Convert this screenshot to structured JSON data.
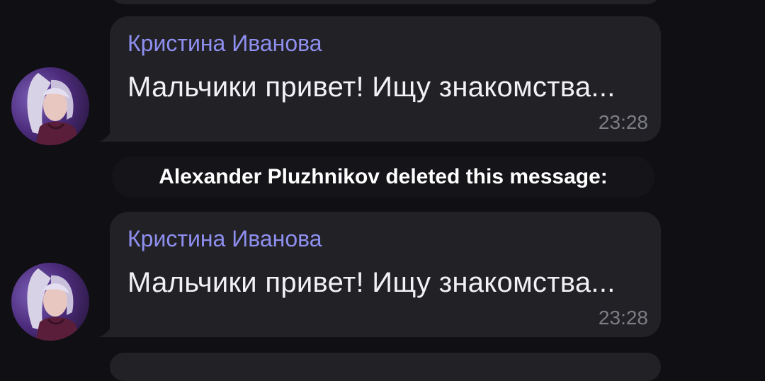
{
  "messages": [
    {
      "sender": "Кристина Иванова",
      "text": "Мальчики привет! Ищу знакомства...",
      "time": "23:28"
    },
    {
      "sender": "Кристина Иванова",
      "text": "Мальчики привет! Ищу знакомства...",
      "time": "23:28"
    }
  ],
  "service_message": "Alexander Pluzhnikov deleted this message:",
  "colors": {
    "background": "#0f0f14",
    "bubble": "#212126",
    "sender_name": "#8f8ff0",
    "message_text": "#f2f2f4",
    "timestamp": "#7d7d86",
    "service_bg": "#141419"
  }
}
